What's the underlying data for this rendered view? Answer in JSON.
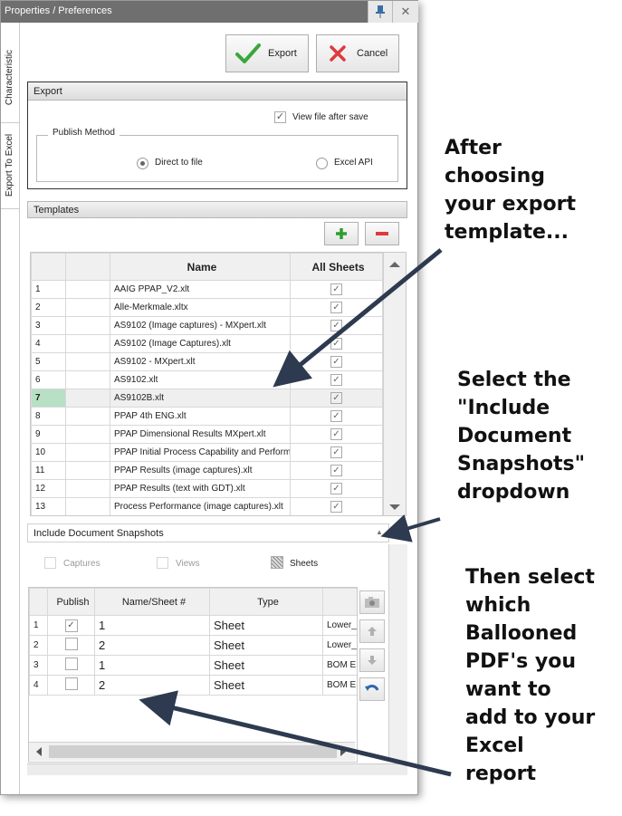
{
  "window": {
    "title": "Properties / Preferences",
    "pin_glyph": "📌",
    "close_glyph": "✕"
  },
  "vertical_tabs": [
    "Characteristic",
    "Export To Excel"
  ],
  "toolbar": {
    "export_label": "Export",
    "cancel_label": "Cancel"
  },
  "export_group": {
    "header": "Export",
    "view_file_after_save": {
      "label": "View file after save",
      "checked": true
    },
    "publish_method": {
      "legend": "Publish Method",
      "options": [
        {
          "label": "Direct to file",
          "selected": true
        },
        {
          "label": "Excel API",
          "selected": false
        }
      ]
    }
  },
  "templates": {
    "header": "Templates",
    "add_glyph": "✚",
    "remove_glyph": "—",
    "columns": [
      "",
      "Name",
      "All Sheets"
    ],
    "rows": [
      {
        "num": "1",
        "name": "AAIG PPAP_V2.xlt",
        "all_sheets": true
      },
      {
        "num": "2",
        "name": "Alle-Merkmale.xltx",
        "all_sheets": true
      },
      {
        "num": "3",
        "name": "AS9102 (Image captures) - MXpert.xlt",
        "all_sheets": true
      },
      {
        "num": "4",
        "name": "AS9102 (Image Captures).xlt",
        "all_sheets": true
      },
      {
        "num": "5",
        "name": "AS9102 - MXpert.xlt",
        "all_sheets": true
      },
      {
        "num": "6",
        "name": "AS9102.xlt",
        "all_sheets": true
      },
      {
        "num": "7",
        "name": "AS9102B.xlt",
        "all_sheets": true,
        "selected": true
      },
      {
        "num": "8",
        "name": "PPAP 4th ENG.xlt",
        "all_sheets": true
      },
      {
        "num": "9",
        "name": "PPAP Dimensional Results MXpert.xlt",
        "all_sheets": true
      },
      {
        "num": "10",
        "name": "PPAP Initial Process Capability and Performa",
        "all_sheets": true
      },
      {
        "num": "11",
        "name": "PPAP Results (image captures).xlt",
        "all_sheets": true
      },
      {
        "num": "12",
        "name": "PPAP Results (text with GDT).xlt",
        "all_sheets": true
      },
      {
        "num": "13",
        "name": "Process Performance (image captures).xlt",
        "all_sheets": true
      }
    ]
  },
  "snapshots": {
    "header": "Include Document Snapshots",
    "options": [
      {
        "label": "Captures",
        "checked": false
      },
      {
        "label": "Views",
        "checked": false
      },
      {
        "label": "Sheets",
        "checked": true
      }
    ],
    "columns": [
      "",
      "Publish",
      "Name/Sheet #",
      "Type",
      ""
    ],
    "rows": [
      {
        "num": "1",
        "publish": true,
        "name": "1",
        "type": "Sheet",
        "extra": "Lower_"
      },
      {
        "num": "2",
        "publish": false,
        "name": "2",
        "type": "Sheet",
        "extra": "Lower_"
      },
      {
        "num": "3",
        "publish": false,
        "name": "1",
        "type": "Sheet",
        "extra": "BOM E"
      },
      {
        "num": "4",
        "publish": false,
        "name": "2",
        "type": "Sheet",
        "extra": "BOM E"
      }
    ]
  },
  "annotations": {
    "a1": "After\nchoosing\nyour export\ntemplate...",
    "a2": "Select the\n\"Include\nDocument\nSnapshots\"\ndropdown",
    "a3": "Then select\nwhich\nBallooned\nPDF's you\nwant to\nadd to your\nExcel\nreport"
  },
  "colors": {
    "titlebar": "#6f6f6f",
    "selected_row_marker": "#b8e0c4",
    "add_green": "#2e9e2e",
    "remove_red": "#e0393e",
    "arrow": "#2d3a4f"
  }
}
